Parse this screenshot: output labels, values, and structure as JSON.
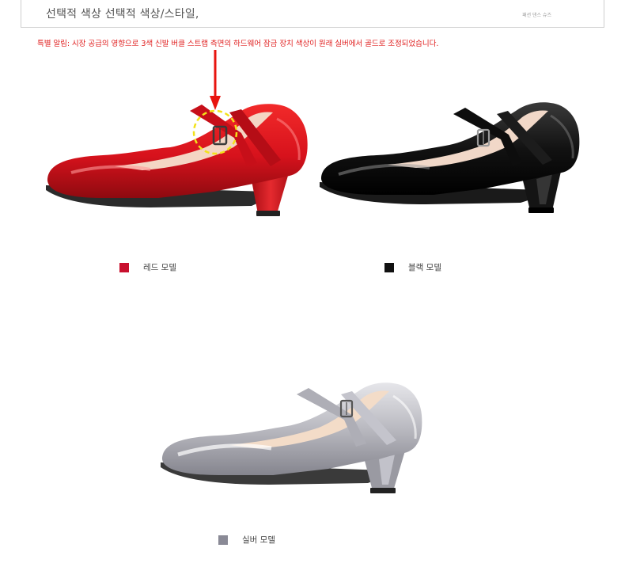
{
  "header": {
    "title": "선택적 색상 선택적 색상/스타일,",
    "watermark": "패션 댄스 슈즈"
  },
  "notice": {
    "text": "특별 알림: 시장 공급의 영향으로 3색 신발 버클 스트랩 측면의 하드웨어 잠금 장치 색상이 원래 실버에서 골드로 조정되었습니다."
  },
  "variants": [
    {
      "label": "레드 모델",
      "swatch_color": "#c8102e",
      "shoe_icon": "red-patent-mary-jane-shoe"
    },
    {
      "label": "블랙 모델",
      "swatch_color": "#111111",
      "shoe_icon": "black-patent-mary-jane-shoe"
    },
    {
      "label": "실버 모델",
      "swatch_color": "#8a8a96",
      "shoe_icon": "silver-mary-jane-shoe"
    }
  ],
  "annotation": {
    "arrow_color": "#e8140f",
    "highlight_color": "#f2e21a"
  }
}
